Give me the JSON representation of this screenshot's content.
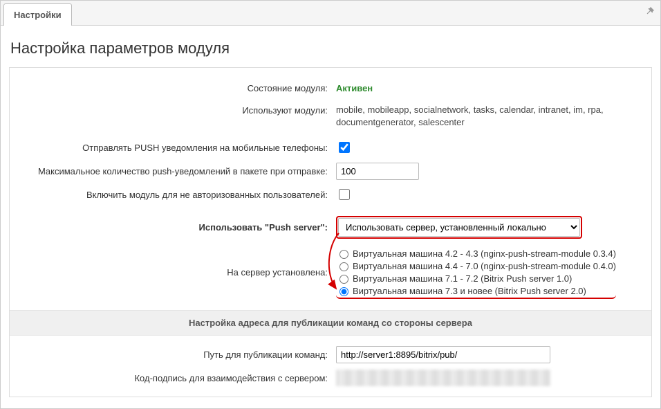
{
  "tab": {
    "label": "Настройки"
  },
  "page": {
    "title": "Настройка параметров модуля"
  },
  "fields": {
    "status_label": "Состояние модуля:",
    "status_value": "Активен",
    "modules_label": "Используют модули:",
    "modules_value": "mobile, mobileapp, socialnetwork, tasks, calendar, intranet, im, rpa, documentgenerator, salescenter",
    "push_mobile_label": "Отправлять PUSH уведомления на мобильные телефоны:",
    "max_push_label": "Максимальное количество push-уведомлений в пакете при отправке:",
    "max_push_value": "100",
    "unauth_label": "Включить модуль для не авторизованных пользователей:",
    "use_push_server_label": "Использовать \"Push server\":",
    "use_push_server_value": "Использовать сервер, установленный локально",
    "installed_on_label": "На сервер установлена:",
    "radio_options": {
      "r0": "Виртуальная машина 4.2 - 4.3 (nginx-push-stream-module 0.3.4)",
      "r1": "Виртуальная машина 4.4 - 7.0 (nginx-push-stream-module 0.4.0)",
      "r2": "Виртуальная машина 7.1 - 7.2 (Bitrix Push server 1.0)",
      "r3": "Виртуальная машина 7.3 и новее (Bitrix Push server 2.0)"
    },
    "section_header": "Настройка адреса для публикации команд со стороны сервера",
    "publish_path_label": "Путь для публикации команд:",
    "publish_path_value": "http://server1:8895/bitrix/pub/",
    "signature_label": "Код-подпись для взаимодействия с сервером:"
  }
}
